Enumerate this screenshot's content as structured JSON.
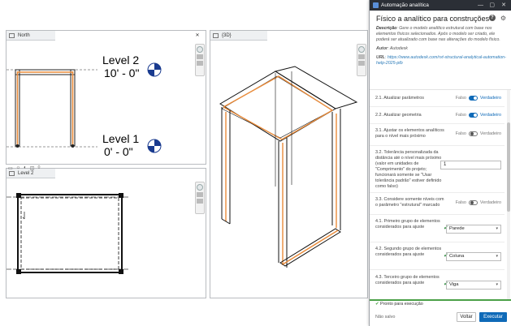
{
  "views": {
    "north": {
      "tab": "North",
      "level_top_name": "Level 2",
      "level_top_elev": "10' - 0\"",
      "level_bottom_name": "Level 1",
      "level_bottom_elev": "0' - 0\""
    },
    "view3d": {
      "tab": "{3D}"
    },
    "plan": {
      "tab": "Level 2"
    }
  },
  "panel": {
    "window_title": "Automação analítica",
    "heading": "Físico a analítico para construções",
    "description_label": "Descrição",
    "description_text": ": Gere o modelo analítico estrutural com base nos elementos físicos selecionados. Após o modelo ser criado, ele poderá ser atualizado com base nas alterações do modelo físico.",
    "author_label": "Autor",
    "author_value": ": Autodesk",
    "url_label": "URL",
    "url_value": ": https://www.autodesk.com/rvt-structural-analytical-automation-help-2025-ptb",
    "false_label": "Falso",
    "true_label": "Verdadeiro",
    "rows": [
      {
        "label": "2.1. Atualizar parâmetros",
        "value": true
      },
      {
        "label": "2.2. Atualizar geometria",
        "value": true
      },
      {
        "label": "3.1. Ajustar os elementos analíticos para o nível mais próximo",
        "value": false
      },
      {
        "label": "3.2. Tolerância personalizada da distância até o nível mais próximo (valor em unidades de \"Comprimento\" do projeto; funcionará somente se \"Usar tolerância padrão\" estiver definido como falso)",
        "input": "1"
      },
      {
        "label": "3.3. Considere somente níveis com o parâmetro \"estrutural\" marcado",
        "value": false
      },
      {
        "label": "4.1. Primeiro grupo de elementos considerados para ajuste",
        "select": "Parede"
      },
      {
        "label": "4.2. Segundo grupo de elementos considerados para ajuste",
        "select": "Coluna"
      },
      {
        "label": "4.3. Terceiro grupo de elementos considerados para ajuste",
        "select": "Viga"
      }
    ],
    "status": "Pronto para execução",
    "saved_state": "Não salvo",
    "cancel_button": "Voltar",
    "run_button": "Executar"
  }
}
